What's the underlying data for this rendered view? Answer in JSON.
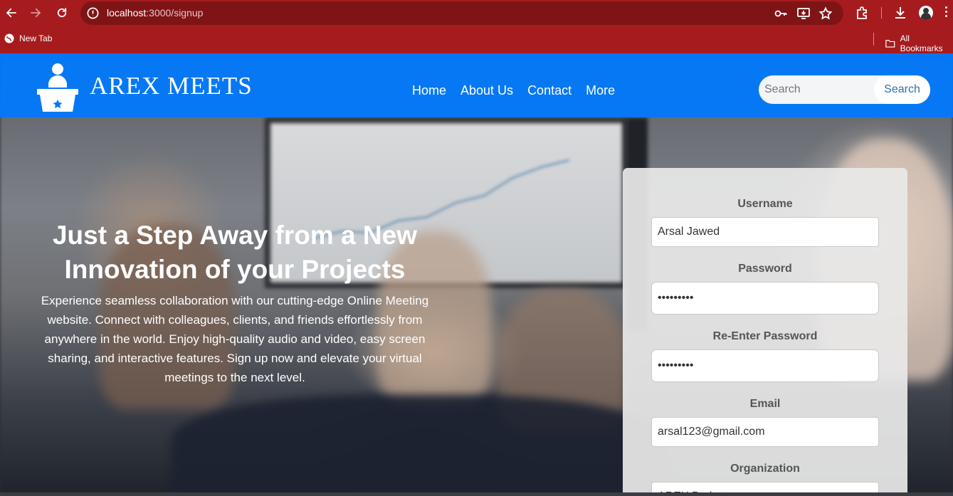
{
  "browser": {
    "url_host": "localhost",
    "url_path": ":3000/signup",
    "bookmarks": {
      "new_tab": "New Tab",
      "all_bookmarks": "All Bookmarks"
    }
  },
  "site": {
    "brand": "AREX MEETS",
    "nav": [
      "Home",
      "About Us",
      "Contact",
      "More"
    ],
    "search": {
      "placeholder": "Search",
      "button": "Search"
    }
  },
  "hero": {
    "title": "Just a Step Away from a New Innovation of your Projects",
    "description": "Experience seamless collaboration with our cutting-edge Online Meeting website. Connect with colleagues, clients, and friends effortlessly from anywhere in the world. Enjoy high-quality audio and video, easy screen sharing, and interactive features. Sign up now and elevate your virtual meetings to the next level."
  },
  "signup": {
    "username_label": "Username",
    "username_value": "Arsal Jawed",
    "password_label": "Password",
    "password_value": "123456789",
    "reenter_label": "Re-Enter Password",
    "reenter_value": "123456789",
    "email_label": "Email",
    "email_value": "arsal123@gmail.com",
    "organization_label": "Organization",
    "organization_value": "AREX Project"
  },
  "colors": {
    "chrome": "#a61b1e",
    "nav": "#007aff",
    "card": "#e8e8e8"
  }
}
